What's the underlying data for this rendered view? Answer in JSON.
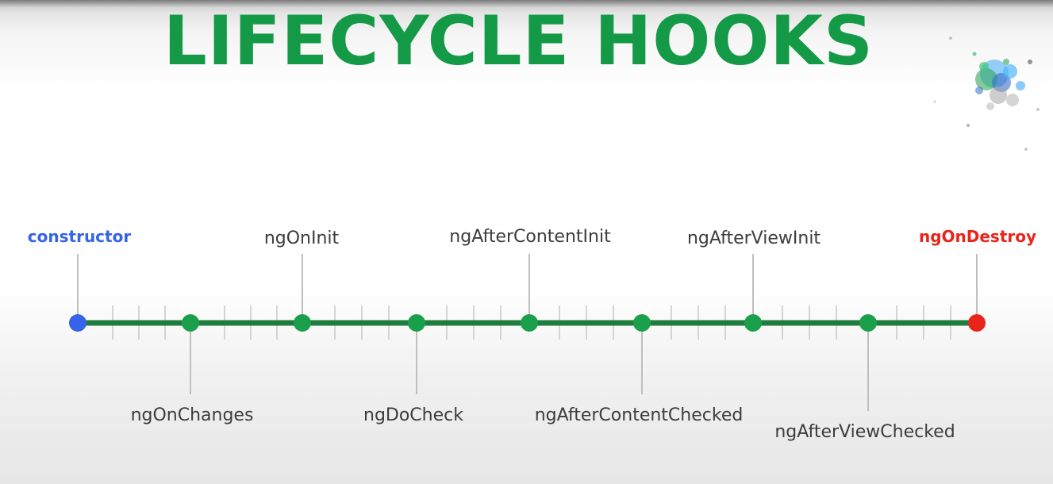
{
  "title": "LIFECYCLE HOOKS",
  "colors": {
    "title": "#149a46",
    "line": "#1e7d3a",
    "hook_dot": "#1aa04a",
    "start": "#3563e9",
    "end": "#e8241b",
    "connector": "#bfbfbf",
    "tick": "#c8c8c8"
  },
  "hooks": {
    "constructor": "constructor",
    "ngOnChanges": "ngOnChanges",
    "ngOnInit": "ngOnInit",
    "ngDoCheck": "ngDoCheck",
    "ngAfterContentInit": "ngAfterContentInit",
    "ngAfterContentChecked": "ngAfterContentChecked",
    "ngAfterViewInit": "ngAfterViewInit",
    "ngAfterViewChecked": "ngAfterViewChecked",
    "ngOnDestroy": "ngOnDestroy"
  },
  "logo_icon": "angular-particles-logo-icon"
}
